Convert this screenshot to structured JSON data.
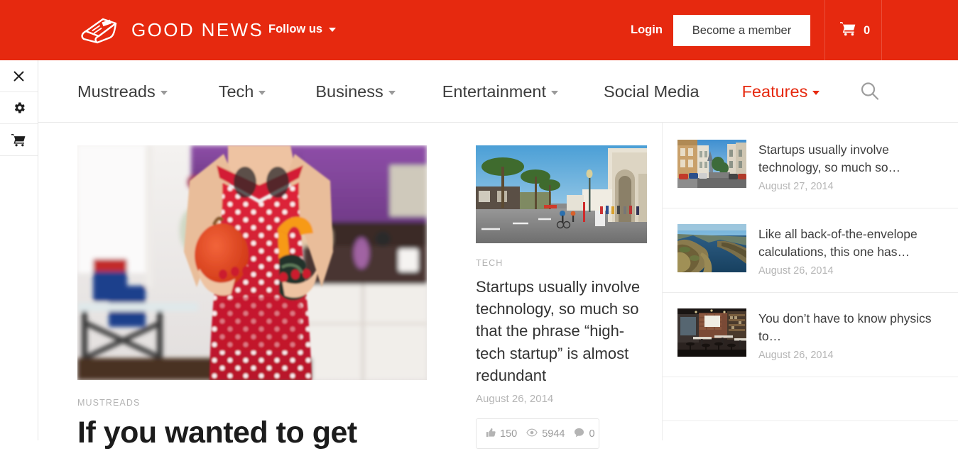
{
  "brand": {
    "name": "GOOD NEWS",
    "logo_icon": "newspaper-icon"
  },
  "header": {
    "follow_us_label": "Follow us",
    "follow_us_caret": "chevron-down-icon",
    "login_label": "Login",
    "member_button_label": "Become a member",
    "cart_icon": "shopping-cart-icon",
    "cart_count": "0",
    "background_color": "#e6290f"
  },
  "tool_rail": {
    "items": [
      {
        "icon": "close-icon",
        "name": "close"
      },
      {
        "icon": "gear-icon",
        "name": "settings"
      },
      {
        "icon": "shopping-cart-icon",
        "name": "cart"
      }
    ]
  },
  "nav": {
    "items": [
      {
        "label": "Mustreads",
        "has_caret": true,
        "accent": false
      },
      {
        "label": "Tech",
        "has_caret": true,
        "accent": false
      },
      {
        "label": "Business",
        "has_caret": true,
        "accent": false
      },
      {
        "label": "Entertainment",
        "has_caret": true,
        "accent": false
      },
      {
        "label": "Social Media",
        "has_caret": false,
        "accent": false
      },
      {
        "label": "Features",
        "has_caret": true,
        "accent": true
      }
    ],
    "accent_color": "#e6290f",
    "search_icon": "search-icon"
  },
  "feature": {
    "image_alt": "woman in red polka dot apron holding pumpkin and squash in kitchen",
    "category": "MUSTREADS",
    "title": "If you wanted to get"
  },
  "middle": {
    "image_alt": "palm tree lined street with people walking",
    "category": "TECH",
    "title": "Startups usually involve technology, so much so that the phrase “high-tech startup” is almost redundant",
    "date": "August 26, 2014",
    "stats": [
      {
        "icon": "thumbs-up-icon",
        "value": "150"
      },
      {
        "icon": "eye-icon",
        "value": "5944"
      },
      {
        "icon": "comment-icon",
        "value": "0"
      }
    ]
  },
  "sidebar": {
    "items": [
      {
        "image_alt": "san francisco hill street with victorian houses",
        "title": "Startups usually involve technology, so much so…",
        "date": "August 27, 2014"
      },
      {
        "image_alt": "coastal cliffs overlooking blue sea",
        "title": "Like all back-of-the-envelope calculations, this one has…",
        "date": "August 26, 2014"
      },
      {
        "image_alt": "industrial brick cafe interior with tables",
        "title": "You don’t have to know physics to…",
        "date": "August 26, 2014"
      }
    ]
  }
}
